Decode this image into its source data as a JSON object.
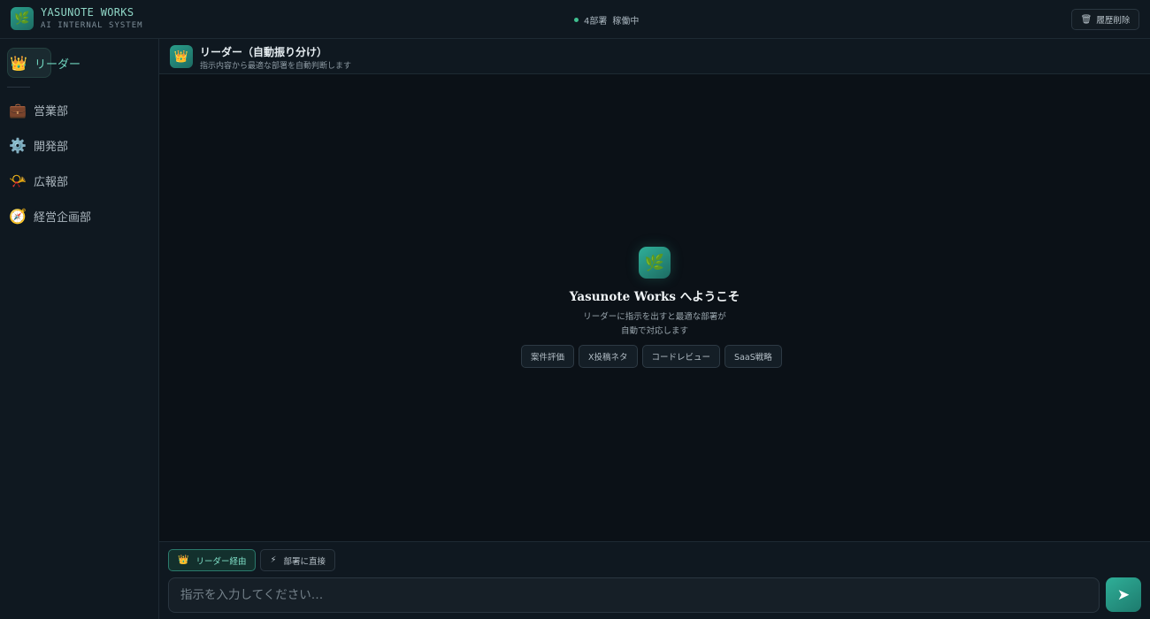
{
  "brand": {
    "name": "YASUNOTE WORKS",
    "subtitle": "AI INTERNAL SYSTEM",
    "logo_icon": "🌿"
  },
  "status": {
    "count": "4部署",
    "state": "稼働中",
    "color": "#3fbf8f"
  },
  "toolbar": {
    "clear_icon": "🗑",
    "clear_label": "履歴削除"
  },
  "sidebar": {
    "items": [
      {
        "icon": "👑",
        "label": "リーダー",
        "active": true
      },
      {
        "icon": "💼",
        "label": "営業部"
      },
      {
        "icon": "⚙️",
        "label": "開発部"
      },
      {
        "icon": "📯",
        "label": "広報部"
      },
      {
        "icon": "🧭",
        "label": "経営企画部"
      }
    ]
  },
  "main_header": {
    "icon": "👑",
    "title": "リーダー（自動振り分け）",
    "subtitle": "指示内容から最適な部署を自動判断します"
  },
  "welcome": {
    "icon": "🌿",
    "title": "Yasunote Works へようこそ",
    "desc_line1": "リーダーに指示を出すと最適な部署が",
    "desc_line2": "自動で対応します",
    "suggestions": [
      "案件評価",
      "X投稿ネタ",
      "コードレビュー",
      "SaaS戦略"
    ]
  },
  "input_area": {
    "modes": [
      {
        "icon": "👑",
        "label": "リーダー経由",
        "active": true
      },
      {
        "icon": "⚡",
        "label": "部署に直接"
      }
    ],
    "placeholder": "指示を入力してください…",
    "value": "",
    "send_icon": "➤"
  },
  "colors": {
    "accent": "#2faf98",
    "background": "#0b1117",
    "panel": "#0f1820"
  }
}
